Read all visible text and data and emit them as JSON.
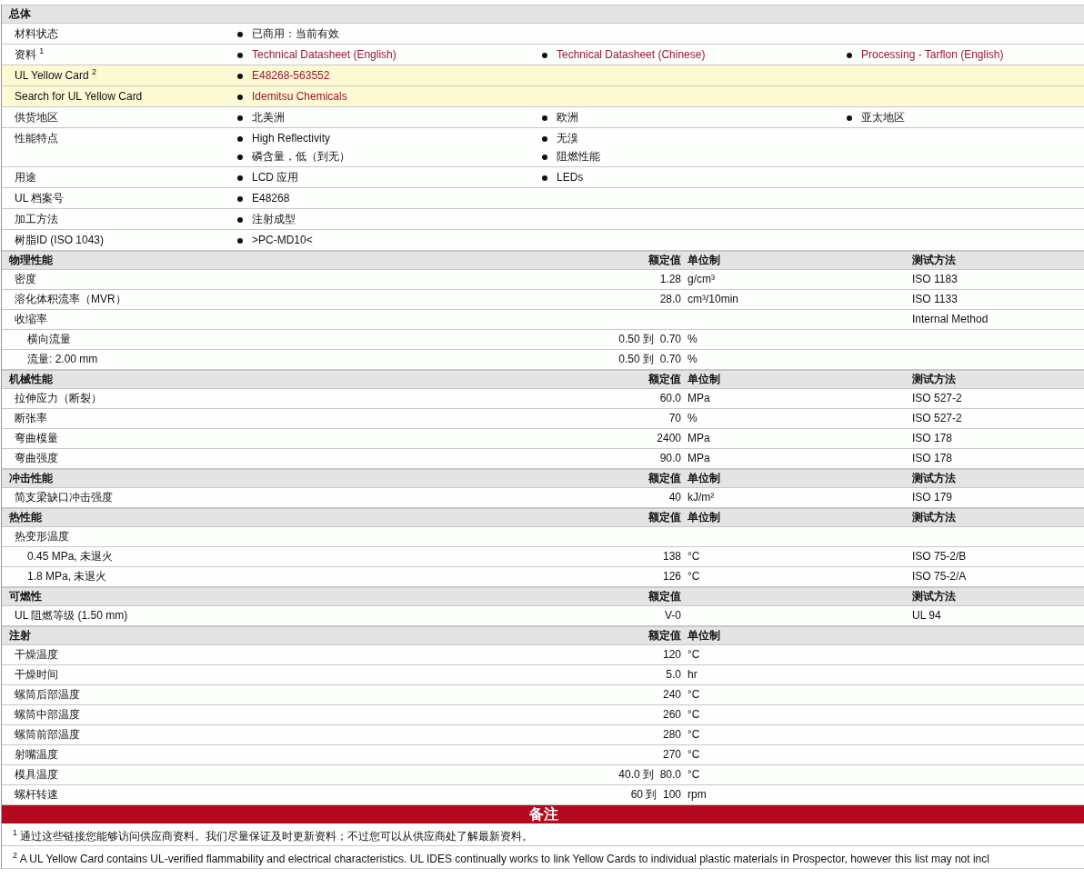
{
  "general": {
    "title": "总体",
    "rows": [
      {
        "label": "材料状态",
        "highlight": false,
        "lines": [
          [
            {
              "text": "已商用：当前有效",
              "kind": "text"
            }
          ]
        ]
      },
      {
        "label": "资料 $^{1}$",
        "highlight": false,
        "lines": [
          [
            {
              "text": "Technical Datasheet (English)",
              "kind": "link"
            },
            {
              "text": "Technical Datasheet (Chinese)",
              "kind": "link"
            },
            {
              "text": "Processing - Tarflon (English)",
              "kind": "link"
            }
          ]
        ]
      },
      {
        "label": "UL Yellow Card $^{2}$",
        "highlight": true,
        "lines": [
          [
            {
              "text": "E48268-563552",
              "kind": "link"
            }
          ]
        ]
      },
      {
        "label": "Search for UL Yellow Card",
        "highlight": true,
        "lines": [
          [
            {
              "text": "Idemitsu Chemicals",
              "kind": "link"
            }
          ]
        ]
      },
      {
        "label": "供货地区",
        "highlight": false,
        "lines": [
          [
            {
              "text": "北美洲",
              "kind": "text"
            },
            {
              "text": "欧洲",
              "kind": "text"
            },
            {
              "text": "亚太地区",
              "kind": "text"
            }
          ]
        ]
      },
      {
        "label": "性能特点",
        "highlight": false,
        "lines": [
          [
            {
              "text": "High Reflectivity",
              "kind": "text"
            },
            {
              "text": "无溴",
              "kind": "text"
            }
          ],
          [
            {
              "text": "磷含量，低（到无）",
              "kind": "text"
            },
            {
              "text": "阻燃性能",
              "kind": "text"
            }
          ]
        ]
      },
      {
        "label": "用途",
        "highlight": false,
        "lines": [
          [
            {
              "text": "LCD 应用",
              "kind": "text"
            },
            {
              "text": "LEDs",
              "kind": "text"
            }
          ]
        ]
      },
      {
        "label": "UL 档案号",
        "highlight": false,
        "lines": [
          [
            {
              "text": "E48268",
              "kind": "text"
            }
          ]
        ]
      },
      {
        "label": "加工方法",
        "highlight": false,
        "lines": [
          [
            {
              "text": "注射成型",
              "kind": "text"
            }
          ]
        ]
      },
      {
        "label": "树脂ID (ISO 1043)",
        "highlight": false,
        "lines": [
          [
            {
              "text": ">PC-MD10<",
              "kind": "text"
            }
          ]
        ]
      }
    ]
  },
  "sections": [
    {
      "title": "物理性能",
      "value_header": "额定值",
      "unit_header": "单位制",
      "method_header": "测试方法",
      "rows": [
        {
          "name": "密度",
          "value": "1.28",
          "unit": "g/cm³",
          "method": "ISO 1183"
        },
        {
          "name": "溶化体积流率（MVR）",
          "value": "28.0",
          "unit": "cm³/10min",
          "method": "ISO 1133"
        },
        {
          "name": "收缩率",
          "method": "Internal Method",
          "children": [
            {
              "name": "横向流量",
              "value": "0.50 到  0.70",
              "unit": "%"
            },
            {
              "name": "流量: 2.00 mm",
              "value": "0.50 到  0.70",
              "unit": "%"
            }
          ]
        }
      ]
    },
    {
      "title": "机械性能",
      "value_header": "额定值",
      "unit_header": "单位制",
      "method_header": "测试方法",
      "rows": [
        {
          "name": "拉伸应力（断裂）",
          "value": "60.0",
          "unit": "MPa",
          "method": "ISO 527-2"
        },
        {
          "name": "断张率",
          "value": "70",
          "unit": "%",
          "method": "ISO 527-2"
        },
        {
          "name": "弯曲模量",
          "value": "2400",
          "unit": "MPa",
          "method": "ISO 178"
        },
        {
          "name": "弯曲强度",
          "value": "90.0",
          "unit": "MPa",
          "method": "ISO 178"
        }
      ]
    },
    {
      "title": "冲击性能",
      "value_header": "额定值",
      "unit_header": "单位制",
      "method_header": "测试方法",
      "rows": [
        {
          "name": "简支梁缺口冲击强度",
          "value": "40",
          "unit": "kJ/m²",
          "method": "ISO 179"
        }
      ]
    },
    {
      "title": "热性能",
      "value_header": "额定值",
      "unit_header": "单位制",
      "method_header": "测试方法",
      "rows": [
        {
          "name": "热变形温度",
          "children": [
            {
              "name": "0.45 MPa, 未退火",
              "value": "138",
              "unit": "°C",
              "method": "ISO 75-2/B"
            },
            {
              "name": "1.8 MPa, 未退火",
              "value": "126",
              "unit": "°C",
              "method": "ISO 75-2/A"
            }
          ]
        }
      ]
    },
    {
      "title": "可燃性",
      "value_header": "额定值",
      "method_header": "测试方法",
      "rows": [
        {
          "name": "UL 阻燃等级 (1.50 mm)",
          "value": "V-0",
          "method": "UL 94"
        }
      ]
    },
    {
      "title": "注射",
      "value_header": "额定值",
      "unit_header": "单位制",
      "rows": [
        {
          "name": "干燥温度",
          "value": "120",
          "unit": "°C"
        },
        {
          "name": "干燥时间",
          "value": "5.0",
          "unit": "hr"
        },
        {
          "name": "螺筒后部温度",
          "value": "240",
          "unit": "°C"
        },
        {
          "name": "螺筒中部温度",
          "value": "260",
          "unit": "°C"
        },
        {
          "name": "螺筒前部温度",
          "value": "280",
          "unit": "°C"
        },
        {
          "name": "射嘴温度",
          "value": "270",
          "unit": "°C"
        },
        {
          "name": "模具温度",
          "value": "40.0 到  80.0",
          "unit": "°C"
        },
        {
          "name": "螺杆转速",
          "value": "60 到  100",
          "unit": "rpm"
        }
      ]
    }
  ],
  "notes": {
    "title": "备注",
    "items": [
      "$^{1}$ 通过这些链接您能够访问供应商资料。我们尽量保证及时更新资料；不过您可以从供应商处了解最新资料。",
      "$^{2}$ A UL Yellow Card contains UL-verified flammability and electrical characteristics. UL IDES continually works to link Yellow Cards to individual plastic materials in Prospector, however this list may not incl"
    ]
  }
}
